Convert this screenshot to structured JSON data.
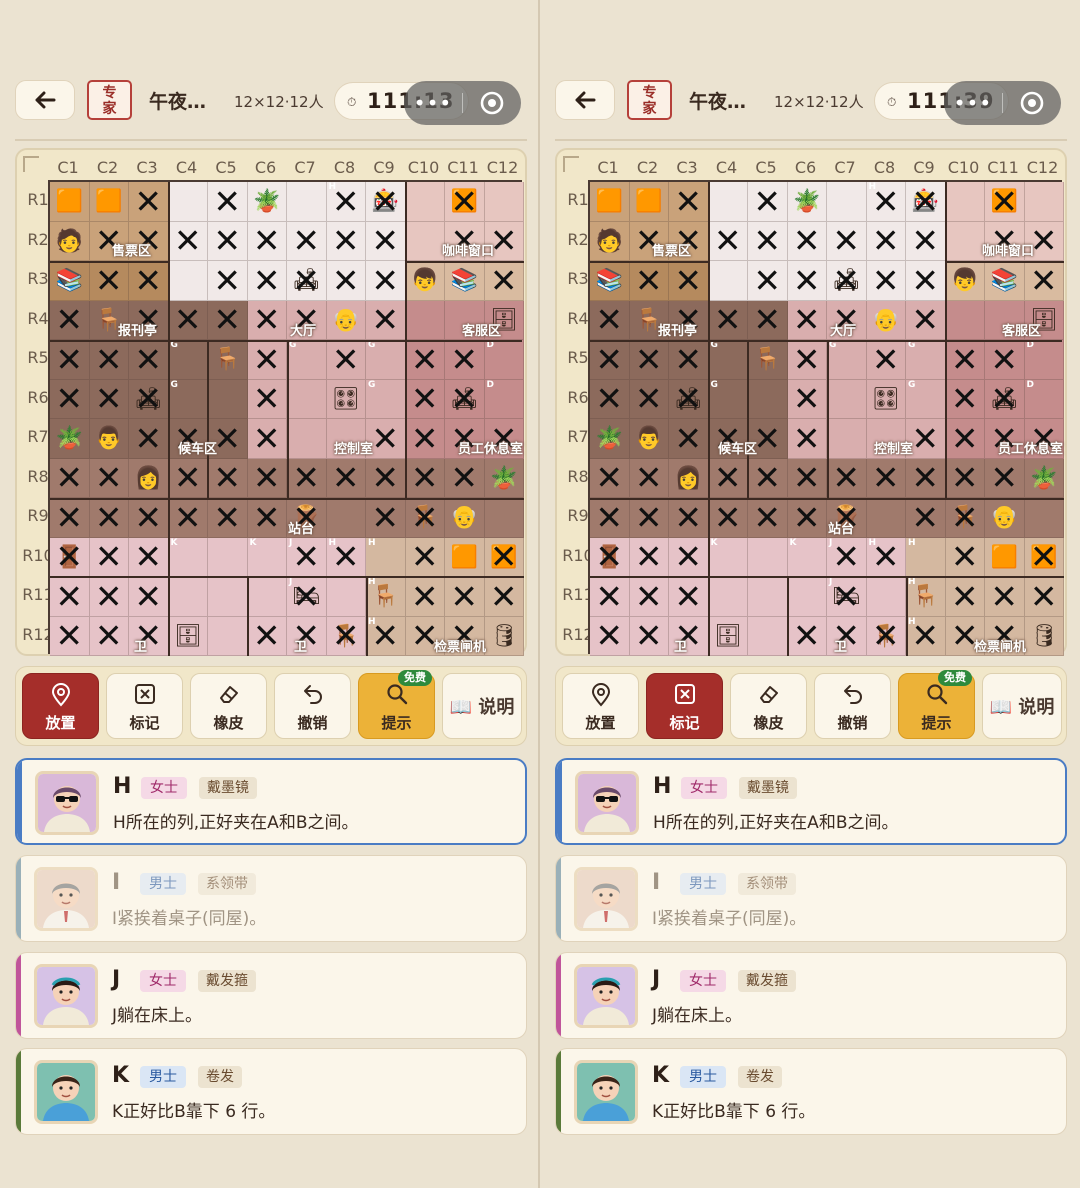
{
  "panels": [
    {
      "timer": "111:13",
      "active_tool": 0,
      "flags": [
        "0000000000100000000001000000000000000000000000000000000000000000000000000000000000000000000000000000000000100000000000000000000000000000000000000000",
        "3"
      ]
    },
    {
      "timer": "111:39",
      "active_tool": 1
    }
  ],
  "header": {
    "back_icon": "arrow-left-icon",
    "difficulty_line1": "专",
    "difficulty_line2": "家",
    "title": "午夜…",
    "size": "12×12·12人",
    "timer_icon": "stopwatch-icon",
    "menu_dots": "•••",
    "menu_close_icon": "target-close-icon"
  },
  "board": {
    "columns": [
      "C1",
      "C2",
      "C3",
      "C4",
      "C5",
      "C6",
      "C7",
      "C8",
      "C9",
      "C10",
      "C11",
      "C12"
    ],
    "rows": [
      "R1",
      "R2",
      "R3",
      "R4",
      "R5",
      "R6",
      "R7",
      "R8",
      "R9",
      "R10",
      "R11",
      "R12"
    ],
    "room_names": [
      "售票区",
      "咖啡窗口",
      "报刊亭",
      "大厅",
      "客服区",
      "候车区",
      "控制室",
      "员工休息室",
      "站台",
      "卫",
      "卫",
      "检票闸机"
    ],
    "cell_tags": {
      "H": "H",
      "G": "G",
      "D": "D",
      "K": "K",
      "J": "J"
    }
  },
  "toolbar": {
    "place": "放置",
    "mark": "标记",
    "eraser": "橡皮",
    "undo": "撤销",
    "hint": "提示",
    "hint_badge": "免费",
    "guide": "📖 说明"
  },
  "clues": [
    {
      "letter": "H",
      "gender": "女士",
      "trait": "戴墨镜",
      "text": "H所在的列,正好夹在A和B之间。",
      "selected": true,
      "dim": false,
      "stripe": "#4a7cc4",
      "gender_class": "female",
      "avatar": "woman-sunglasses-avatar"
    },
    {
      "letter": "I",
      "gender": "男士",
      "trait": "系领带",
      "text": "I紧挨着桌子(同屋)。",
      "selected": false,
      "dim": true,
      "stripe": "#9ab0b8",
      "gender_class": "male",
      "avatar": "man-tie-avatar"
    },
    {
      "letter": "J",
      "gender": "女士",
      "trait": "戴发箍",
      "text": "J躺在床上。",
      "selected": false,
      "dim": false,
      "stripe": "#c0559a",
      "gender_class": "female",
      "avatar": "woman-headband-avatar"
    },
    {
      "letter": "K",
      "gender": "男士",
      "trait": "卷发",
      "text": "K正好比B靠下 6 行。",
      "selected": false,
      "dim": false,
      "stripe": "#5a7a3a",
      "gender_class": "male",
      "avatar": "man-curly-avatar"
    }
  ],
  "colors": {
    "accent_red": "#a52e2a",
    "hint_gold": "#ecb238",
    "selected_blue": "#4a7cc4",
    "board_border": "#3c2a22"
  }
}
